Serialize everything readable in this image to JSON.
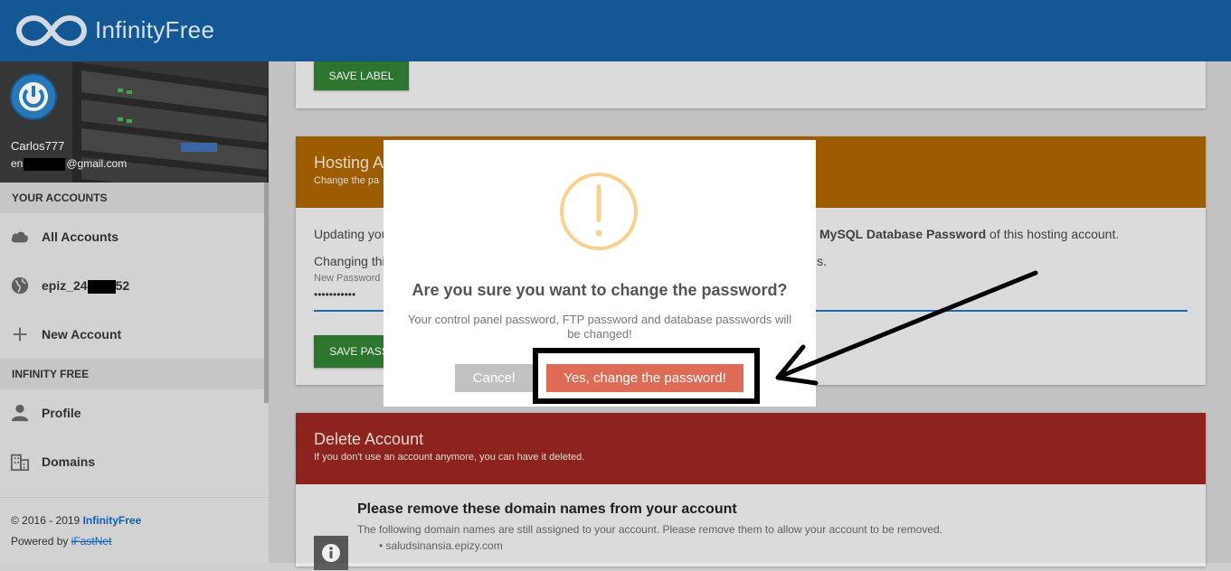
{
  "brand": {
    "name": "InfinityFree"
  },
  "user": {
    "name": "Carlos777",
    "email_prefix": "en",
    "email_suffix": "@gmail.com"
  },
  "sidebar": {
    "sections": [
      {
        "label": "YOUR ACCOUNTS"
      },
      {
        "label": "INFINITY FREE"
      }
    ],
    "items": [
      {
        "label": "All Accounts",
        "icon": "cloud-icon"
      },
      {
        "label_prefix": "epiz_24",
        "label_suffix": "52",
        "icon": "globe-icon"
      },
      {
        "label": "New Account",
        "icon": "plus-icon"
      },
      {
        "label": "Profile",
        "icon": "person-icon"
      },
      {
        "label": "Domains",
        "icon": "building-icon"
      }
    ],
    "footer": {
      "copyright_prefix": "© 2016 - 2019",
      "copyright_link": "InfinityFree",
      "powered_prefix": "Powered by",
      "powered_link": "iFastNet"
    }
  },
  "label_card": {
    "save_button": "SAVE LABEL"
  },
  "hosting_card": {
    "title": "Hosting A",
    "subtitle": "Change the pa",
    "updating_text": "Updating you",
    "mysql_bold": "MySQL Database Password",
    "mysql_rest": " of this hosting account.",
    "changing_text": "Changing thi",
    "changing_end": "s.",
    "new_password_label": "New Password",
    "password_value": "•••••••••••",
    "save_button": "SAVE PASS"
  },
  "delete_card": {
    "title": "Delete Account",
    "subtitle": "If you don't use an account anymore, you can have it deleted.",
    "remove_title": "Please remove these domain names from your account",
    "remove_text": "The following domain names are still assigned to your account. Please remove them to allow your account to be removed.",
    "domains": [
      "saludsinansia.epizy.com"
    ]
  },
  "modal": {
    "title": "Are you sure you want to change the password?",
    "text": "Your control panel password, FTP password and database passwords will be changed!",
    "cancel_label": "Cancel",
    "confirm_label": "Yes, change the password!"
  },
  "colors": {
    "topbar": "#155e9e",
    "hosting_header": "#a76200",
    "delete_header": "#962621",
    "save_button": "#2e7d32",
    "confirm_button": "#dd6b55",
    "cancel_button": "#c1c1c1",
    "warning": "#f8d08f"
  }
}
